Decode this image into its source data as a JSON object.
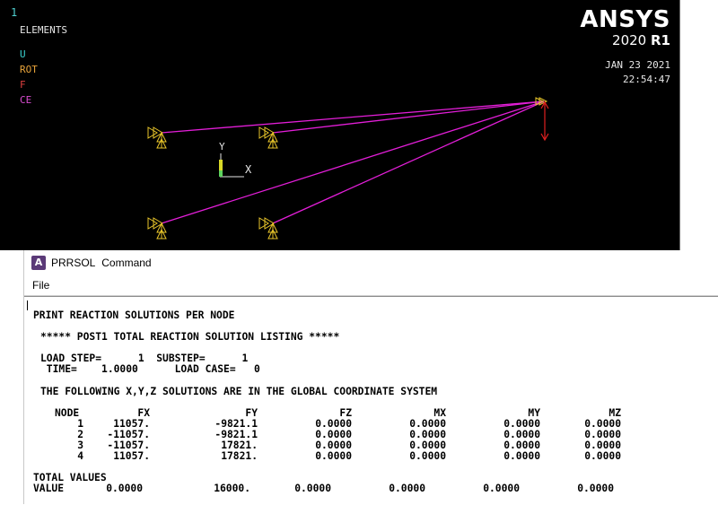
{
  "viewport": {
    "window_number": "1",
    "plot_type": "ELEMENTS",
    "legend": [
      "U",
      "ROT",
      "F",
      "CE"
    ],
    "brand_name": "ANSYS",
    "brand_version_year": "2020",
    "brand_version_rel": "R1",
    "date": "JAN 23 2021",
    "time": "22:54:47",
    "triad": {
      "y_label": "Y",
      "x_label": "X"
    },
    "colors": {
      "background": "#000000",
      "elements": "#e31ed8",
      "constraints": "#e8c52a",
      "force_arrow": "#e02020"
    }
  },
  "command_window": {
    "app_icon_letter": "A",
    "title": "PRRSOL Command",
    "menu": [
      "File"
    ],
    "output": {
      "heading": "PRINT REACTION SOLUTIONS PER NODE",
      "listing_title": "***** POST1 TOTAL REACTION SOLUTION LISTING *****",
      "load_step_line": "LOAD STEP=      1  SUBSTEP=      1",
      "time_line": " TIME=    1.0000      LOAD CASE=   0",
      "coord_note": "THE FOLLOWING X,Y,Z SOLUTIONS ARE IN THE GLOBAL COORDINATE SYSTEM",
      "columns": [
        "NODE",
        "FX",
        "FY",
        "FZ",
        "MX",
        "MY",
        "MZ"
      ],
      "rows": [
        [
          "1",
          "11057.",
          "-9821.1",
          "0.0000",
          "0.0000",
          "0.0000",
          "0.0000"
        ],
        [
          "2",
          "-11057.",
          "-9821.1",
          "0.0000",
          "0.0000",
          "0.0000",
          "0.0000"
        ],
        [
          "3",
          "-11057.",
          "17821.",
          "0.0000",
          "0.0000",
          "0.0000",
          "0.0000"
        ],
        [
          "4",
          "11057.",
          "17821.",
          "0.0000",
          "0.0000",
          "0.0000",
          "0.0000"
        ]
      ],
      "total_label": "TOTAL VALUES",
      "value_label": "VALUE",
      "totals": [
        "0.0000",
        "16000.",
        "0.0000",
        "0.0000",
        "0.0000",
        "0.0000"
      ]
    }
  }
}
